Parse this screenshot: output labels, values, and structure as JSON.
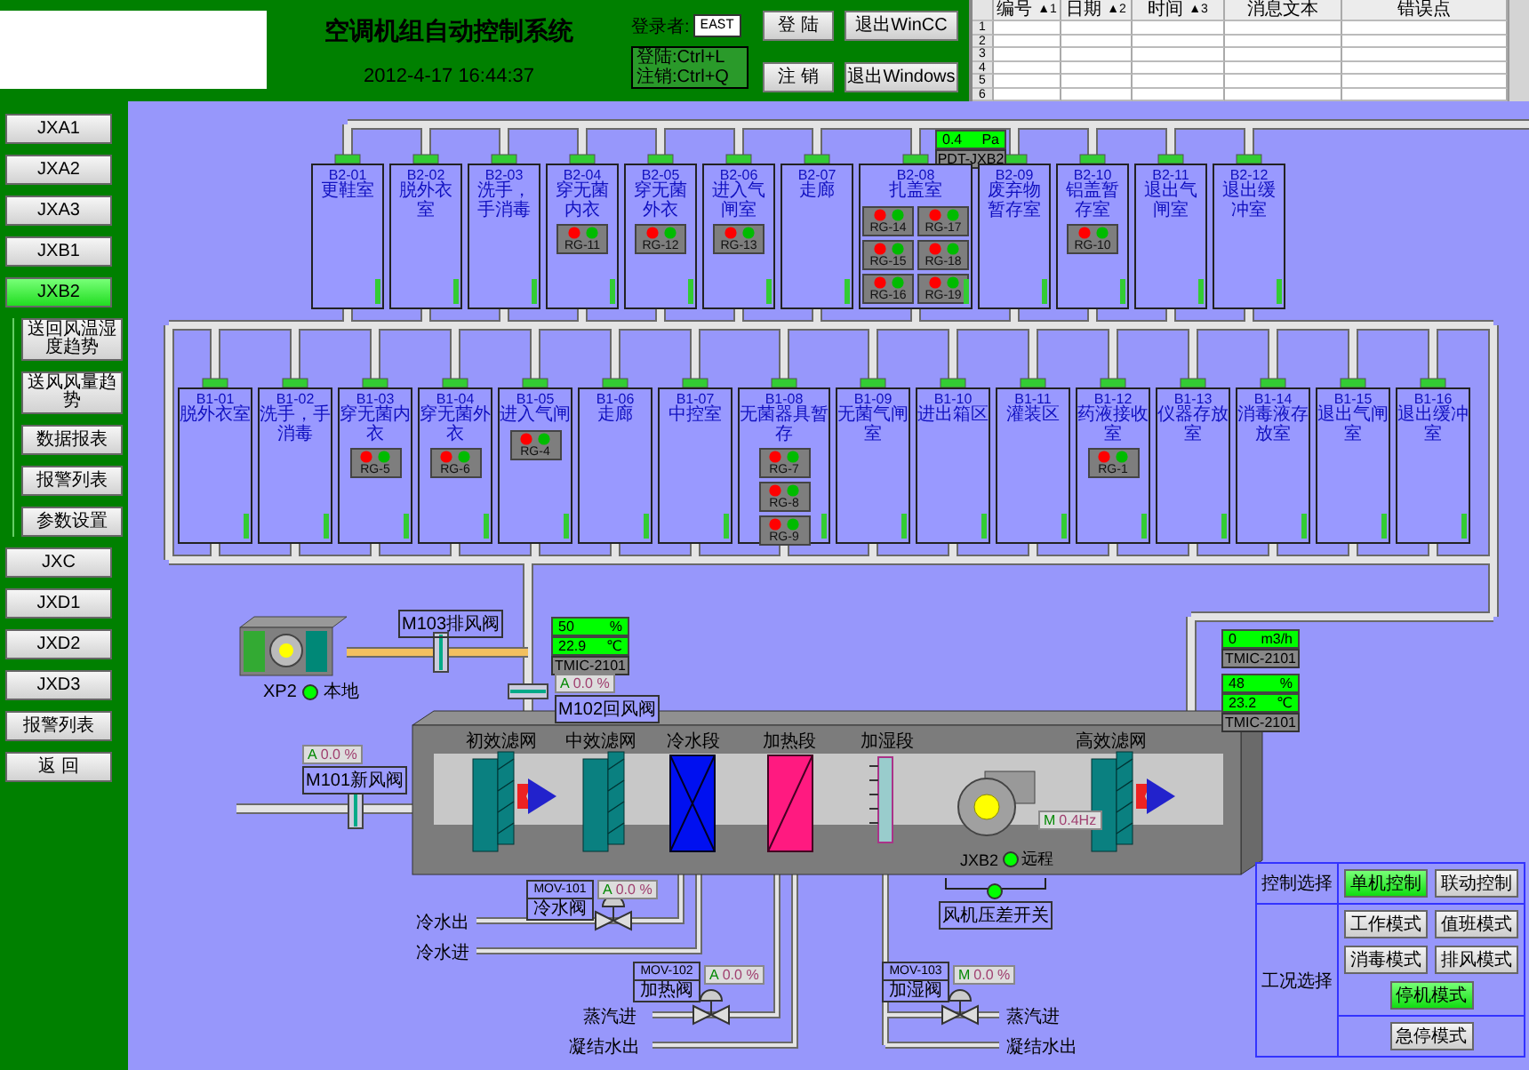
{
  "header": {
    "title": "空调机组自动控制系统",
    "datetime": "2012-4-17 16:44:37",
    "login_label": "登录者:",
    "user": "EAST",
    "hints": [
      "登陆:Ctrl+L",
      "注销:Ctrl+Q"
    ],
    "buttons": [
      {
        "label": "登 陆"
      },
      {
        "label": "退出WinCC"
      },
      {
        "label": "注 销"
      },
      {
        "label": "退出Windows"
      }
    ]
  },
  "alarm_table": {
    "columns": [
      {
        "label": "编号",
        "sort": "▲1"
      },
      {
        "label": "日期",
        "sort": "▲2"
      },
      {
        "label": "时间",
        "sort": "▲3"
      },
      {
        "label": "消息文本"
      },
      {
        "label": "错误点"
      }
    ],
    "rows": [
      "1",
      "2",
      "3",
      "4",
      "5",
      "6"
    ]
  },
  "sidebar": {
    "items": [
      {
        "label": "JXA1",
        "selected": false
      },
      {
        "label": "JXA2",
        "selected": false
      },
      {
        "label": "JXA3",
        "selected": false
      },
      {
        "label": "JXB1",
        "selected": false
      },
      {
        "label": "JXB2",
        "selected": true,
        "children": [
          {
            "label": "送回风温湿度趋势"
          },
          {
            "label": "送风风量趋势"
          },
          {
            "label": "数据报表"
          },
          {
            "label": "报警列表"
          },
          {
            "label": "参数设置"
          }
        ]
      },
      {
        "label": "JXC",
        "selected": false
      },
      {
        "label": "JXD1",
        "selected": false
      },
      {
        "label": "JXD2",
        "selected": false
      },
      {
        "label": "JXD3",
        "selected": false
      },
      {
        "label": "报警列表",
        "selected": false
      },
      {
        "label": "返 回",
        "selected": false
      }
    ]
  },
  "pressure_sensor": {
    "value": "0.4",
    "unit": "Pa",
    "tag": "PDT-JXB2"
  },
  "rooms_upper": [
    {
      "code": "B2-01",
      "name": "更鞋室"
    },
    {
      "code": "B2-02",
      "name": "脱外衣室"
    },
    {
      "code": "B2-03",
      "name": "洗手，手消毒"
    },
    {
      "code": "B2-04",
      "name": "穿无菌内衣",
      "devices": [
        {
          "tag": "RG-11"
        }
      ]
    },
    {
      "code": "B2-05",
      "name": "穿无菌外衣",
      "devices": [
        {
          "tag": "RG-12"
        }
      ]
    },
    {
      "code": "B2-06",
      "name": "进入气闸室",
      "devices": [
        {
          "tag": "RG-13"
        }
      ]
    },
    {
      "code": "B2-07",
      "name": "走廊"
    },
    {
      "code": "B2-08",
      "name": "扎盖室",
      "devices": [
        {
          "tag": "RG-14"
        },
        {
          "tag": "RG-17"
        },
        {
          "tag": "RG-15"
        },
        {
          "tag": "RG-18"
        },
        {
          "tag": "RG-16"
        },
        {
          "tag": "RG-19"
        }
      ]
    },
    {
      "code": "B2-09",
      "name": "废弃物暂存室"
    },
    {
      "code": "B2-10",
      "name": "铝盖暂存室",
      "devices": [
        {
          "tag": "RG-10"
        }
      ]
    },
    {
      "code": "B2-11",
      "name": "退出气闸室"
    },
    {
      "code": "B2-12",
      "name": "退出缓冲室"
    }
  ],
  "rooms_lower": [
    {
      "code": "B1-01",
      "name": "脱外衣室"
    },
    {
      "code": "B1-02",
      "name": "洗手，手消毒"
    },
    {
      "code": "B1-03",
      "name": "穿无菌内衣",
      "devices": [
        {
          "tag": "RG-5"
        }
      ]
    },
    {
      "code": "B1-04",
      "name": "穿无菌外衣",
      "devices": [
        {
          "tag": "RG-6"
        }
      ]
    },
    {
      "code": "B1-05",
      "name": "进入气闸",
      "devices": [
        {
          "tag": "RG-4"
        }
      ]
    },
    {
      "code": "B1-06",
      "name": "走廊"
    },
    {
      "code": "B1-07",
      "name": "中控室"
    },
    {
      "code": "B1-08",
      "name": "无菌器具暂存",
      "devices": [
        {
          "tag": "RG-7"
        },
        {
          "tag": "RG-8"
        },
        {
          "tag": "RG-9"
        }
      ]
    },
    {
      "code": "B1-09",
      "name": "无菌气闸室"
    },
    {
      "code": "B1-10",
      "name": "进出箱区"
    },
    {
      "code": "B1-11",
      "name": "灌装区"
    },
    {
      "code": "B1-12",
      "name": "药液接收室",
      "devices": [
        {
          "tag": "RG-1"
        }
      ]
    },
    {
      "code": "B1-13",
      "name": "仪器存放室"
    },
    {
      "code": "B1-14",
      "name": "消毒液存放室"
    },
    {
      "code": "B1-15",
      "name": "退出气闸室"
    },
    {
      "code": "B1-16",
      "name": "退出缓冲室"
    }
  ],
  "exhaust_fan": {
    "tag": "XP2",
    "status": "本地",
    "on": true
  },
  "exhaust_damper": {
    "label": "M103排风阀"
  },
  "return_sensor": {
    "lines": [
      {
        "value": "50",
        "unit": "%"
      },
      {
        "value": "22.9",
        "unit": "℃"
      }
    ],
    "tag": "TMIC-2101"
  },
  "return_damper": {
    "label": "M102回风阀",
    "mode": "A",
    "value": "0.0 %"
  },
  "fresh_damper": {
    "label": "M101新风阀",
    "mode": "A",
    "value": "0.0 %"
  },
  "supply_flow": {
    "lines": [
      {
        "value": "0",
        "unit": "m3/h"
      }
    ],
    "tag": "TMIC-2101"
  },
  "supply_sensor": {
    "lines": [
      {
        "value": "48",
        "unit": "%"
      },
      {
        "value": "23.2",
        "unit": "℃"
      }
    ],
    "tag": "TMIC-2101"
  },
  "sections": [
    {
      "label": "初效滤网",
      "kind": "filter"
    },
    {
      "label": "中效滤网",
      "kind": "filter"
    },
    {
      "label": "冷水段",
      "kind": "cooling_coil"
    },
    {
      "label": "加热段",
      "kind": "heating_coil"
    },
    {
      "label": "加湿段",
      "kind": "humidifier"
    },
    {
      "label": "高效滤网",
      "kind": "filter"
    }
  ],
  "supply_fan": {
    "tag": "JXB2",
    "status": "远程",
    "on": true,
    "mode": "M",
    "value": "0.4Hz"
  },
  "pressure_switch": {
    "label": "风机压差开关",
    "on": true
  },
  "valves": [
    {
      "tag": "MOV-101",
      "name": "冷水阀",
      "mode": "A",
      "value": "0.0 %",
      "pipes": [
        "冷水出",
        "冷水进"
      ]
    },
    {
      "tag": "MOV-102",
      "name": "加热阀",
      "mode": "A",
      "value": "0.0 %",
      "pipes": [
        "蒸汽进",
        "凝结水出"
      ]
    },
    {
      "tag": "MOV-103",
      "name": "加湿阀",
      "mode": "M",
      "value": "0.0 %",
      "pipes": [
        "蒸汽进",
        "凝结水出"
      ]
    }
  ],
  "control_panel": {
    "control_label": "控制选择",
    "control_buttons": [
      {
        "label": "单机控制",
        "selected": true
      },
      {
        "label": "联动控制",
        "selected": false
      }
    ],
    "mode_label": "工况选择",
    "mode_buttons": [
      {
        "label": "工作模式",
        "selected": false
      },
      {
        "label": "值班模式",
        "selected": false
      },
      {
        "label": "消毒模式",
        "selected": false
      },
      {
        "label": "排风模式",
        "selected": false
      },
      {
        "label": "停机模式",
        "selected": true
      }
    ],
    "emergency_buttons": [
      {
        "label": "急停模式",
        "selected": false
      }
    ]
  }
}
